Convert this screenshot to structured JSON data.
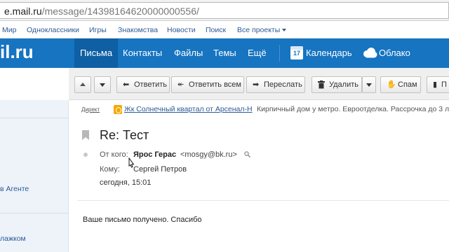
{
  "browser": {
    "url_host": "e.mail.ru",
    "url_path": "/message/14398164620000000556/"
  },
  "portal_nav": {
    "items": [
      "Мир",
      "Одноклассники",
      "Игры",
      "Знакомства",
      "Новости",
      "Поиск",
      "Все проекты"
    ]
  },
  "header": {
    "logo_text": "il.ru",
    "tabs": [
      "Письма",
      "Контакты",
      "Файлы",
      "Темы",
      "Ещё"
    ],
    "calendar_label": "Календарь",
    "calendar_day": "17",
    "cloud_label": "Облако"
  },
  "toolbar": {
    "reply_label": "Ответить",
    "reply_all_label": "Ответить всем",
    "forward_label": "Переслать",
    "delete_label": "Удалить",
    "spam_label": "Спам",
    "more_label": "П"
  },
  "sidebar": {
    "links": [
      "в Агенте",
      "лажком"
    ]
  },
  "ad": {
    "label": "Директ",
    "title": "Жк Солнечный квартал от Арсенал-Н",
    "text": "Кирпичный дом у метро. Евроотделка. Рассрочка до 3 лет. О"
  },
  "message": {
    "subject": "Re: Тест",
    "from_label": "От кого:",
    "from_name": "Ярос Герас",
    "from_email": "<mosgy@bk.ru>",
    "to_label": "Кому:",
    "to_name": "Сергей Петров",
    "date": "сегодня, 15:01",
    "body": "Ваше письмо получено. Спасибо"
  },
  "colors": {
    "header_blue": "#1674c1",
    "active_tab": "#0e5fa3",
    "link_blue": "#2b5a97",
    "logo_accent": "#ff9e00"
  }
}
